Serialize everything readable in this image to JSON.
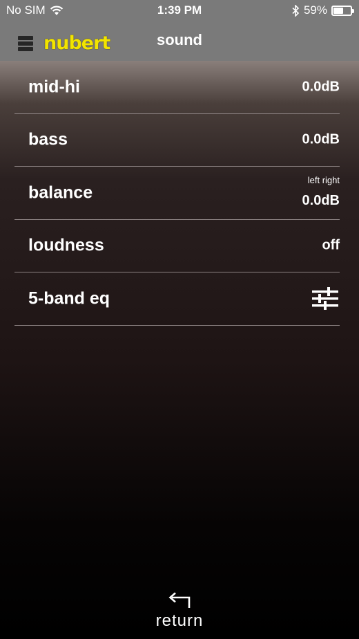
{
  "status_bar": {
    "carrier": "No SIM",
    "time": "1:39 PM",
    "battery_percent": "59%",
    "battery_level": 0.59,
    "icons": [
      "wifi-icon",
      "bluetooth-icon",
      "battery-icon"
    ]
  },
  "nav": {
    "logo": "nubert",
    "title": "sound",
    "logo_color": "#f2e400"
  },
  "rows": [
    {
      "label": "mid-hi",
      "value": "0.0dB"
    },
    {
      "label": "bass",
      "value": "0.0dB"
    },
    {
      "label": "balance",
      "sub": "left right",
      "value": "0.0dB"
    },
    {
      "label": "loudness",
      "value": "off"
    },
    {
      "label": "5-band eq",
      "icon": "equalizer-sliders-icon"
    }
  ],
  "footer": {
    "return_label": "return",
    "icon": "return-arrow-icon"
  }
}
